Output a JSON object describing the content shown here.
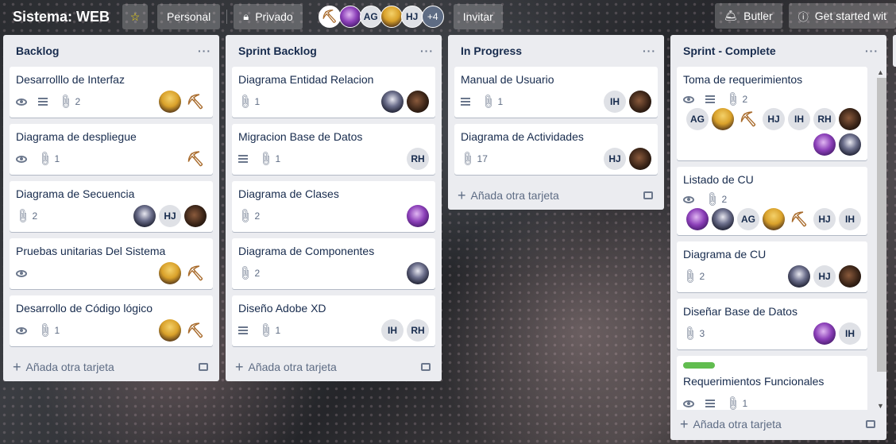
{
  "header": {
    "title": "Sistema: WEB",
    "visibility_team": "Personal",
    "visibility_private": "Privado",
    "members": [
      "AG",
      "HJ"
    ],
    "more_members": "+4",
    "invite": "Invitar",
    "butler": "Butler",
    "get_started": "Get started wit"
  },
  "lists": [
    {
      "title": "Backlog",
      "add_card": "Añada otra tarjeta",
      "cards": [
        {
          "title": "Desarrolllo de Interfaz",
          "attachments": "2"
        },
        {
          "title": "Diagrama de despliegue",
          "attachments": "1"
        },
        {
          "title": "Diagrama de Secuencia",
          "attachments": "2",
          "avatar_hj": "HJ"
        },
        {
          "title": "Pruebas unitarias Del Sistema"
        },
        {
          "title": "Desarrollo de Código lógico",
          "attachments": "1"
        }
      ]
    },
    {
      "title": "Sprint Backlog",
      "add_card": "Añada otra tarjeta",
      "cards": [
        {
          "title": "Diagrama Entidad Relacion",
          "attachments": "1"
        },
        {
          "title": "Migracion Base de Datos",
          "attachments": "1",
          "avatar_rh": "RH"
        },
        {
          "title": "Diagrama de Clases",
          "attachments": "2"
        },
        {
          "title": "Diagrama de Componentes",
          "attachments": "2"
        },
        {
          "title": "Diseño Adobe XD",
          "attachments": "1",
          "avatar_ih": "IH",
          "avatar_rh": "RH"
        }
      ]
    },
    {
      "title": "In Progress",
      "add_card": "Añada otra tarjeta",
      "cards": [
        {
          "title": "Manual de Usuario",
          "attachments": "1",
          "avatar_ih": "IH"
        },
        {
          "title": "Diagrama de Actividades",
          "attachments": "17",
          "avatar_hj": "HJ"
        }
      ]
    },
    {
      "title": "Sprint - Complete",
      "add_card": "Añada otra tarjeta",
      "cards": [
        {
          "title": "Toma de requerimientos",
          "attachments": "2",
          "avatar_ag": "AG",
          "avatar_hj": "HJ",
          "avatar_ih": "IH",
          "avatar_rh": "RH"
        },
        {
          "title": "Listado de CU",
          "attachments": "2",
          "avatar_ag": "AG",
          "avatar_hj": "HJ",
          "avatar_ih": "IH"
        },
        {
          "title": "Diagrama de CU",
          "attachments": "2",
          "avatar_hj": "HJ"
        },
        {
          "title": "Diseñar Base de Datos",
          "attachments": "3",
          "avatar_ih": "IH"
        },
        {
          "title": "Requerimientos Funcionales",
          "attachments": "1"
        }
      ]
    }
  ],
  "colors": {
    "label_green": "#61bd4f",
    "star": "#f5d90a",
    "list_bg": "#ebecf0"
  }
}
